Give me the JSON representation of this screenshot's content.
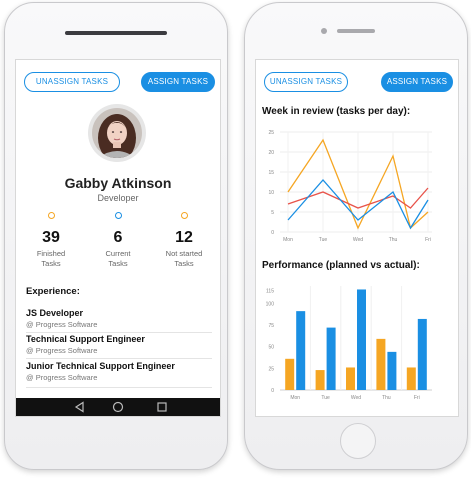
{
  "profile": {
    "unassign_label": "UNASSIGN TASKS",
    "assign_label": "ASSIGN TASKS",
    "name": "Gabby Atkinson",
    "role": "Developer",
    "stats": [
      {
        "value": "39",
        "label_line1": "Finished",
        "label_line2": "Tasks",
        "color": "#f5a623"
      },
      {
        "value": "6",
        "label_line1": "Current",
        "label_line2": "Tasks",
        "color": "#1a8fe3"
      },
      {
        "value": "12",
        "label_line1": "Not started",
        "label_line2": "Tasks",
        "color": "#f5a623"
      }
    ],
    "experience_title": "Experience:",
    "experience": [
      {
        "title": "JS Developer",
        "company": "@ Progress Software"
      },
      {
        "title": "Technical Support Engineer",
        "company": "@ Progress Software"
      },
      {
        "title": "Junior Technical Support Engineer",
        "company": "@ Progress Software"
      }
    ]
  },
  "dashboard": {
    "unassign_label": "UNASSIGN TASKS",
    "assign_label": "ASSIGN TASKS",
    "week_title": "Week in review (tasks per day):",
    "perf_title": "Performance (planned vs actual):"
  },
  "colors": {
    "accent": "#1a8fe3",
    "orange": "#f5a623",
    "red": "#e8534a",
    "blue": "#1a8fe3"
  },
  "chart_data": [
    {
      "type": "line",
      "title": "Week in review (tasks per day):",
      "categories": [
        "Mon",
        "Tue",
        "Wed",
        "Thu",
        "Fri"
      ],
      "ylim": [
        0,
        25
      ],
      "yticks": [
        "25",
        "20",
        "15",
        "10",
        "5",
        "0"
      ],
      "series": [
        {
          "color": "#f5a623",
          "values": [
            10,
            23,
            1,
            19,
            1,
            5
          ]
        },
        {
          "color": "#e8534a",
          "values": [
            7,
            10,
            6,
            9,
            6,
            11
          ]
        },
        {
          "color": "#1a8fe3",
          "values": [
            3,
            13,
            3,
            10,
            1,
            8
          ]
        }
      ],
      "x_points": [
        0,
        1,
        2,
        3,
        3.5,
        4
      ],
      "grid": true
    },
    {
      "type": "bar",
      "title": "Performance (planned vs actual):",
      "categories": [
        "Mon",
        "Tue",
        "Wed",
        "Thu",
        "Fri"
      ],
      "ylim": [
        0,
        115
      ],
      "yticks": [
        "115",
        "100",
        "75",
        "50",
        "25",
        "0"
      ],
      "series": [
        {
          "color": "#f5a623",
          "values": [
            36,
            23,
            26,
            59,
            26
          ]
        },
        {
          "color": "#1a8fe3",
          "values": [
            91,
            72,
            116,
            44,
            82
          ]
        }
      ],
      "grid": false
    }
  ]
}
